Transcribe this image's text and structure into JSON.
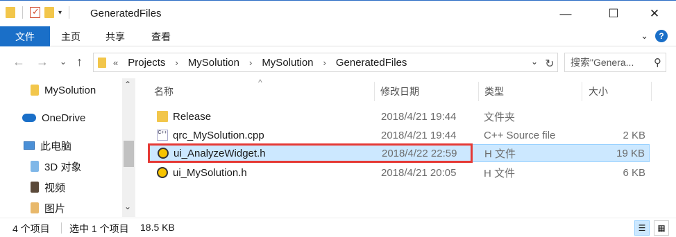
{
  "window": {
    "title": "GeneratedFiles",
    "minimize": "—",
    "maximize": "☐",
    "close": "✕"
  },
  "ribbon": {
    "file_tab": "文件",
    "tabs": [
      "主页",
      "共享",
      "查看"
    ],
    "expand": "⌄",
    "help": "?"
  },
  "address": {
    "back": "←",
    "forward": "→",
    "recent": "⌄",
    "up": "↑",
    "prefix": "«",
    "crumbs": [
      "Projects",
      "MySolution",
      "MySolution",
      "GeneratedFiles"
    ],
    "separator": "›",
    "dropdown": "⌄",
    "refresh": "↻",
    "search_placeholder": "搜索\"Genera...",
    "search_icon": "⚲"
  },
  "nav": {
    "items": [
      {
        "label": "MySolution",
        "icon": "folder-icon"
      },
      {
        "label": "OneDrive",
        "icon": "onedrive-icon"
      },
      {
        "label": "此电脑",
        "icon": "computer-icon"
      },
      {
        "label": "3D 对象",
        "icon": "3d-objects-icon"
      },
      {
        "label": "视频",
        "icon": "videos-icon"
      },
      {
        "label": "图片",
        "icon": "pictures-icon"
      }
    ],
    "scroll_up": "⌃",
    "scroll_down": "⌄"
  },
  "columns": {
    "name": "名称",
    "date": "修改日期",
    "type": "类型",
    "size": "大小",
    "sort_indicator": "^"
  },
  "files": [
    {
      "name": "Release",
      "date": "2018/4/21 19:44",
      "type": "文件夹",
      "size": "",
      "icon": "folder-icon"
    },
    {
      "name": "qrc_MySolution.cpp",
      "date": "2018/4/21 19:44",
      "type": "C++ Source file",
      "size": "2 KB",
      "icon": "cpp-file-icon"
    },
    {
      "name": "ui_AnalyzeWidget.h",
      "date": "2018/4/22 22:59",
      "type": "H 文件",
      "size": "19 KB",
      "icon": "header-file-icon",
      "selected": true
    },
    {
      "name": "ui_MySolution.h",
      "date": "2018/4/21 20:05",
      "type": "H 文件",
      "size": "6 KB",
      "icon": "header-file-icon"
    }
  ],
  "status": {
    "count": "4 个项目",
    "selection": "选中 1 个项目",
    "size": "18.5 KB"
  },
  "colors": {
    "accent": "#1a6fc8",
    "selection": "#cce8ff",
    "highlight_border": "#e53935",
    "folder": "#f2c64b"
  }
}
